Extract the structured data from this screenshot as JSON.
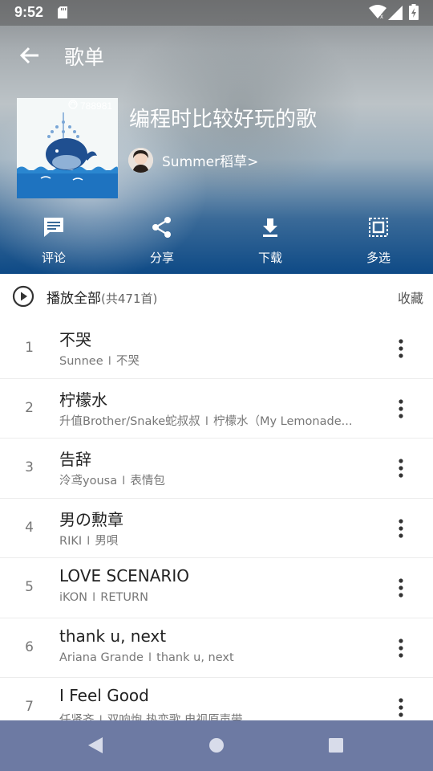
{
  "status_bar": {
    "time": "9:52",
    "icons": [
      "sd-card-icon",
      "wifi-icon",
      "signal-icon",
      "battery-icon"
    ]
  },
  "toolbar": {
    "title": "歌单",
    "back_icon": "arrow-back-icon"
  },
  "playlist": {
    "play_count": "788981",
    "title": "编程时比较好玩的歌",
    "creator": "Summer稻草>"
  },
  "actions": [
    {
      "label": "评论",
      "icon": "comment-icon"
    },
    {
      "label": "分享",
      "icon": "share-icon"
    },
    {
      "label": "下载",
      "icon": "download-icon"
    },
    {
      "label": "多选",
      "icon": "multi-select-icon"
    }
  ],
  "play_all": {
    "label": "播放全部",
    "count": "(共471首)",
    "collect": "收藏"
  },
  "songs": [
    {
      "index": "1",
      "name": "不哭",
      "artist": "Sunnee",
      "album": "不哭"
    },
    {
      "index": "2",
      "name": "柠檬水",
      "artist": "升值Brother/Snake蛇叔叔",
      "album": "柠檬水（My Lemonade..."
    },
    {
      "index": "3",
      "name": "告辞",
      "artist": "泠鸢yousa",
      "album": "表情包"
    },
    {
      "index": "4",
      "name": "男の勲章",
      "artist": "RIKI",
      "album": "男唄"
    },
    {
      "index": "5",
      "name": "LOVE SCENARIO",
      "artist": "iKON",
      "album": "RETURN"
    },
    {
      "index": "6",
      "name": "thank u, next",
      "artist": "Ariana Grande",
      "album": "thank u, next"
    },
    {
      "index": "7",
      "name": "I Feel Good",
      "artist": "任贤齐",
      "album": "双响炮 热恋歌 电视原声带"
    }
  ],
  "colors": {
    "header_dark": "#0e4a86",
    "nav_bar": "#6d7aa3",
    "primary_text": "#222222",
    "secondary_text": "#777777"
  }
}
